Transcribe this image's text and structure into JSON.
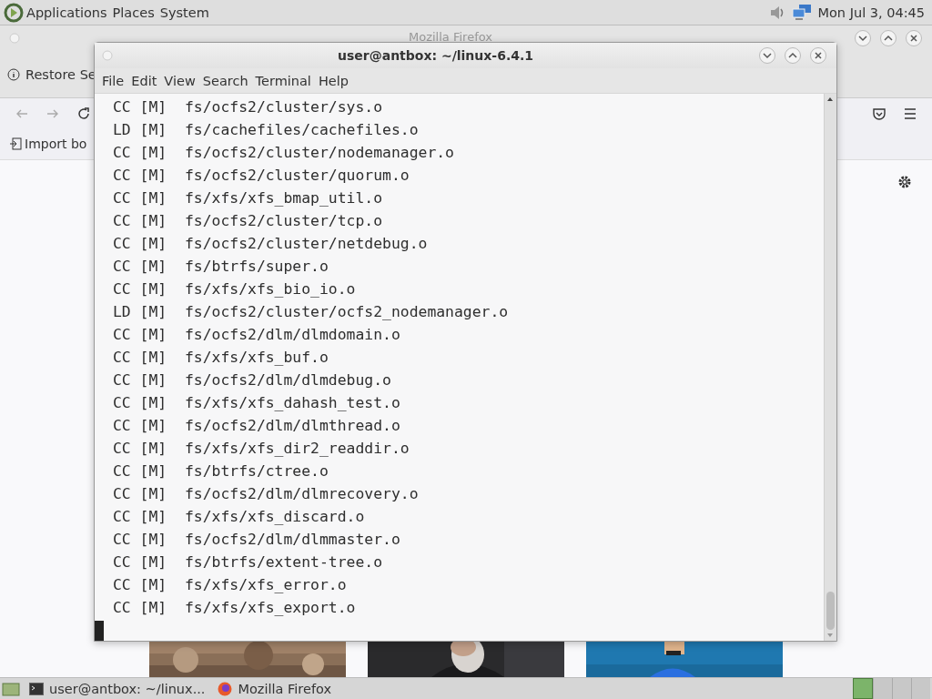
{
  "top_panel": {
    "menus": [
      "Applications",
      "Places",
      "System"
    ],
    "clock": "Mon Jul 3, 04:45"
  },
  "firefox": {
    "title": "Mozilla Firefox",
    "notification": "Restore Se",
    "bookmark": "Import bo"
  },
  "terminal": {
    "title": "user@antbox: ~/linux-6.4.1",
    "menus": [
      "File",
      "Edit",
      "View",
      "Search",
      "Terminal",
      "Help"
    ],
    "lines": [
      "CC [M]  fs/ocfs2/cluster/sys.o",
      "LD [M]  fs/cachefiles/cachefiles.o",
      "CC [M]  fs/ocfs2/cluster/nodemanager.o",
      "CC [M]  fs/ocfs2/cluster/quorum.o",
      "CC [M]  fs/xfs/xfs_bmap_util.o",
      "CC [M]  fs/ocfs2/cluster/tcp.o",
      "CC [M]  fs/ocfs2/cluster/netdebug.o",
      "CC [M]  fs/btrfs/super.o",
      "CC [M]  fs/xfs/xfs_bio_io.o",
      "LD [M]  fs/ocfs2/cluster/ocfs2_nodemanager.o",
      "CC [M]  fs/ocfs2/dlm/dlmdomain.o",
      "CC [M]  fs/xfs/xfs_buf.o",
      "CC [M]  fs/ocfs2/dlm/dlmdebug.o",
      "CC [M]  fs/xfs/xfs_dahash_test.o",
      "CC [M]  fs/ocfs2/dlm/dlmthread.o",
      "CC [M]  fs/xfs/xfs_dir2_readdir.o",
      "CC [M]  fs/btrfs/ctree.o",
      "CC [M]  fs/ocfs2/dlm/dlmrecovery.o",
      "CC [M]  fs/xfs/xfs_discard.o",
      "CC [M]  fs/ocfs2/dlm/dlmmaster.o",
      "CC [M]  fs/btrfs/extent-tree.o",
      "CC [M]  fs/xfs/xfs_error.o",
      "CC [M]  fs/xfs/xfs_export.o"
    ]
  },
  "taskbar": {
    "tasks": [
      {
        "kind": "terminal",
        "label": "user@antbox: ~/linux..."
      },
      {
        "kind": "browser",
        "label": "Mozilla Firefox"
      }
    ],
    "workspaces": [
      {
        "selected": true
      },
      {
        "selected": false
      },
      {
        "selected": false
      },
      {
        "selected": false
      }
    ]
  }
}
